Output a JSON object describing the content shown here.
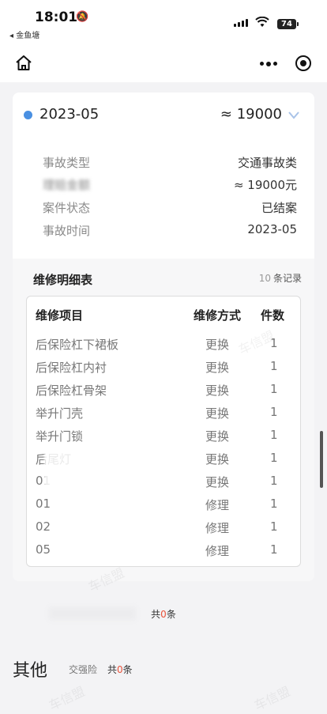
{
  "status_bar": {
    "time": "18:01",
    "back_app": "◂ 金鱼塘",
    "battery": "74"
  },
  "record": {
    "date": "2023-05",
    "amount": "≈ 19000",
    "info": [
      {
        "key": "事故类型",
        "value": "交通事故类"
      },
      {
        "key": "理赔金额",
        "value": "≈ 19000元"
      },
      {
        "key": "案件状态",
        "value": "已结案"
      },
      {
        "key": "事故时间",
        "value": "2023-05"
      }
    ]
  },
  "repair_table": {
    "title": "维修明细表",
    "count": "10",
    "count_unit": "条记录",
    "headers": [
      "维修项目",
      "维修方式",
      "件数"
    ],
    "rows": [
      {
        "item": "后保险杠下裙板",
        "method": "更换",
        "qty": "1"
      },
      {
        "item": "后保险杠内衬",
        "method": "更换",
        "qty": "1"
      },
      {
        "item": "后保险杠骨架",
        "method": "更换",
        "qty": "1"
      },
      {
        "item": "举升门壳",
        "method": "更换",
        "qty": "1"
      },
      {
        "item": "举升门锁",
        "method": "更换",
        "qty": "1"
      },
      {
        "item": "后尾灯",
        "method": "更换",
        "qty": "1"
      },
      {
        "item": "01",
        "method": "更换",
        "qty": "1"
      },
      {
        "item": "01",
        "method": "修理",
        "qty": "1"
      },
      {
        "item": "02",
        "method": "修理",
        "qty": "1"
      },
      {
        "item": "05",
        "method": "修理",
        "qty": "1"
      }
    ]
  },
  "totals": {
    "prefix": "共",
    "count": "0",
    "suffix": "条"
  },
  "other": {
    "title": "其他",
    "subtitle": "交强险",
    "prefix": "共",
    "count": "0",
    "suffix": "条"
  },
  "colors": {
    "accent_dot": "#4a90e2",
    "highlight": "#e8513a"
  }
}
